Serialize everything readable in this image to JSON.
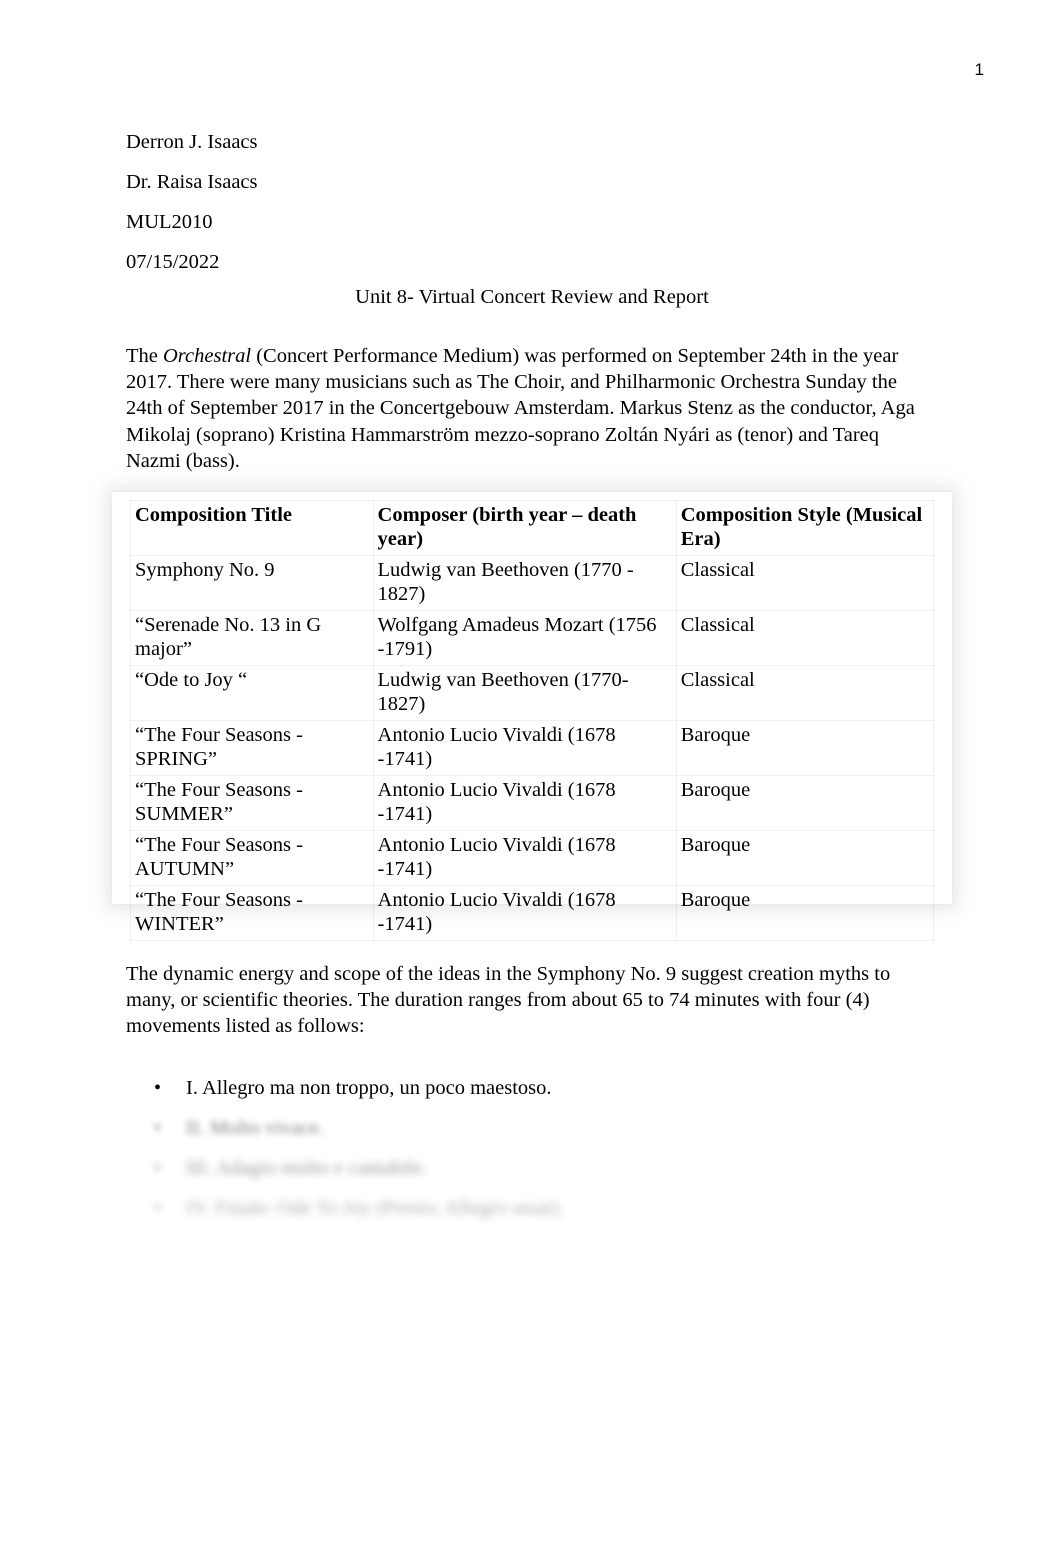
{
  "document": {
    "page_number": "1",
    "title": "Unit 8- Virtual Concert Review and Report",
    "heading": {
      "student_name": "Derron J. Isaacs",
      "instructor": "Dr. Raisa Isaacs",
      "course": "MUL2010",
      "date": "07/15/2022"
    },
    "intro_paragraph": {
      "lead": "The ",
      "italic_term": "Orchestral",
      "rest": " (Concert Performance Medium) was performed on September 24th in the year 2017. There were many musicians such as The Choir, and Philharmonic Orchestra Sunday the 24th of September 2017 in the Concertgebouw Amsterdam. Markus Stenz as the conductor, Aga Mikolaj (soprano) Kristina Hammarström mezzo-soprano Zoltán Nyári as (tenor) and Tareq Nazmi (bass)."
    },
    "body_paragraph": "The dynamic energy and scope of the ideas in the Symphony No. 9 suggest creation myths to many, or scientific theories. The duration ranges from about 65 to 74 minutes with four (4) movements listed as follows:",
    "table": {
      "columns": [
        "Composition Title",
        "Composer (birth year – death year)",
        "Composition Style (Musical Era)"
      ],
      "rows": [
        {
          "title": "Symphony No. 9",
          "composer": "Ludwig van Beethoven (1770 - 1827)",
          "style": "Classical"
        },
        {
          "title": "“Serenade No. 13 in G major”",
          "composer": "Wolfgang Amadeus Mozart (1756 -1791)",
          "style": "Classical"
        },
        {
          "title": "“Ode to Joy “",
          "composer": "Ludwig van Beethoven (1770-1827)",
          "style": "Classical"
        },
        {
          "title": "“The Four Seasons - SPRING”",
          "composer": "Antonio Lucio Vivaldi (1678 -1741)",
          "style": "Baroque"
        },
        {
          "title": "“The Four Seasons - SUMMER”",
          "composer": "Antonio Lucio Vivaldi (1678 -1741)",
          "style": "Baroque"
        },
        {
          "title": "“The Four Seasons - AUTUMN”",
          "composer": "Antonio Lucio Vivaldi (1678 -1741)",
          "style": "Baroque"
        },
        {
          "title": "“The Four Seasons - WINTER”",
          "composer": "Antonio Lucio Vivaldi (1678 -1741)",
          "style": "Baroque"
        }
      ]
    },
    "movements": {
      "bullet_glyph": "•",
      "items": [
        {
          "text": "I. Allegro ma non troppo, un poco maestoso."
        },
        {
          "text": "II. Molto vivace."
        },
        {
          "text": "III. Adagio molto e cantabile."
        },
        {
          "text": "IV. Finale: Ode To Joy (Presto; Allegro assai)."
        }
      ]
    }
  }
}
